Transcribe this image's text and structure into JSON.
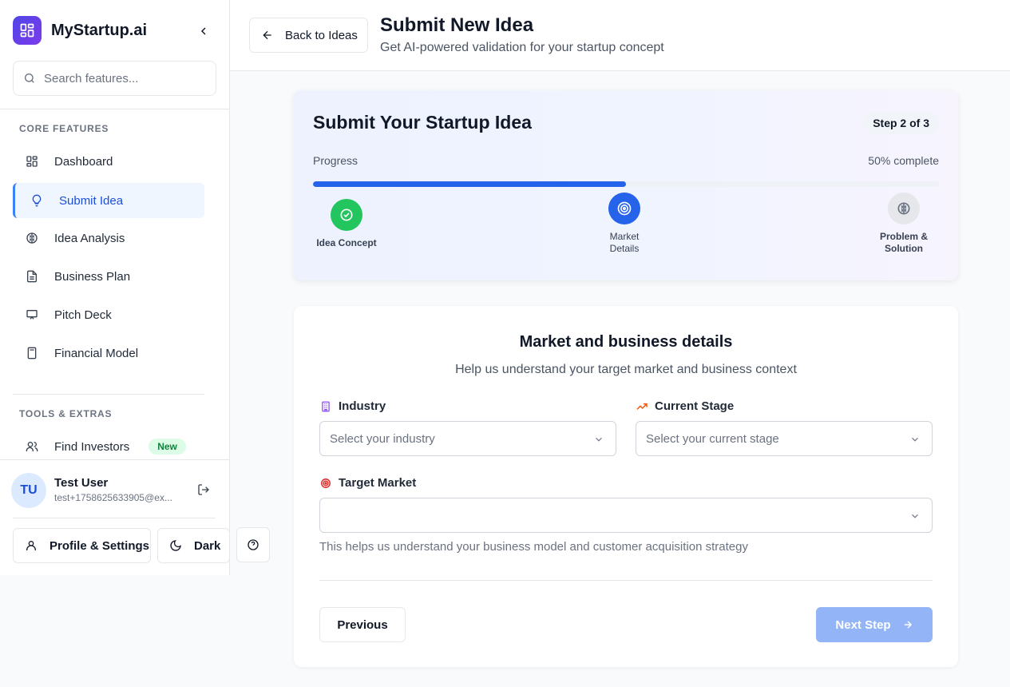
{
  "sidebar": {
    "brand": "MyStartup.ai",
    "search_placeholder": "Search features...",
    "core_label": "CORE FEATURES",
    "core_items": [
      {
        "label": "Dashboard",
        "icon": "dashboard-icon"
      },
      {
        "label": "Submit Idea",
        "icon": "lightbulb-icon",
        "active": true
      },
      {
        "label": "Idea Analysis",
        "icon": "brain-icon"
      },
      {
        "label": "Business Plan",
        "icon": "document-icon"
      },
      {
        "label": "Pitch Deck",
        "icon": "presentation-icon"
      },
      {
        "label": "Financial Model",
        "icon": "calculator-icon"
      }
    ],
    "tools_label": "TOOLS & EXTRAS",
    "tools_items": [
      {
        "label": "Find Investors",
        "icon": "users-icon",
        "badge": "New"
      }
    ],
    "user": {
      "initials": "TU",
      "name": "Test User",
      "email": "test+1758625633905@ex..."
    },
    "profile_label": "Profile & Settings",
    "theme_label": "Dark"
  },
  "header": {
    "back_label": "Back to Ideas",
    "title": "Submit New Idea",
    "subtitle": "Get AI-powered validation for your startup concept"
  },
  "progress": {
    "title": "Submit Your Startup Idea",
    "step_badge": "Step 2 of 3",
    "label": "Progress",
    "complete_text": "50% complete",
    "fraction": 0.5,
    "steps": [
      {
        "line1": "Idea Concept",
        "line2": "",
        "state": "done"
      },
      {
        "line1": "Market",
        "line2": "Details",
        "state": "current"
      },
      {
        "line1": "Problem &",
        "line2": "Solution",
        "state": "upcoming"
      }
    ]
  },
  "form": {
    "title": "Market and business details",
    "subtitle": "Help us understand your target market and business context",
    "industry_label": "Industry",
    "industry_placeholder": "Select your industry",
    "stage_label": "Current Stage",
    "stage_placeholder": "Select your current stage",
    "target_label": "Target Market",
    "target_value": "",
    "hint": "This helps us understand your business model and customer acquisition strategy",
    "prev_label": "Previous",
    "next_label": "Next Step"
  },
  "colors": {
    "primary": "#2563eb",
    "accent_purple": "#7c3aed",
    "success": "#22c55e",
    "next_disabled": "#93b4f7"
  }
}
